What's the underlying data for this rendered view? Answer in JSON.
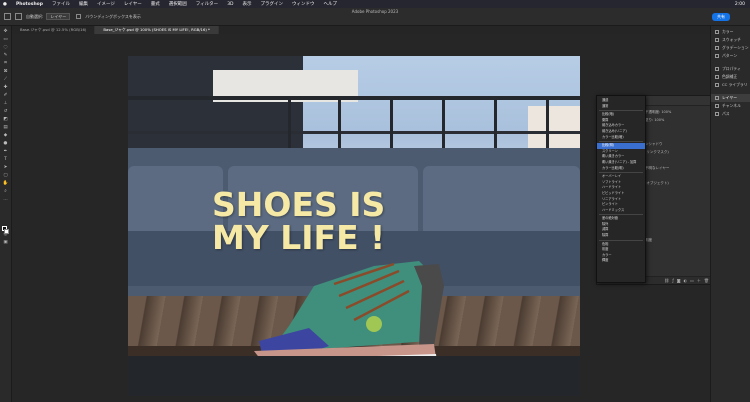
{
  "menubar": {
    "app": "Photoshop",
    "items": [
      "ファイル",
      "編集",
      "イメージ",
      "レイヤー",
      "書式",
      "選択範囲",
      "フィルター",
      "3D",
      "表示",
      "プラグイン",
      "ウィンドウ",
      "ヘルプ"
    ],
    "clock": "2:00"
  },
  "window_title": "Adobe Photoshop 2023",
  "options_bar": {
    "auto_select_label": "自動選択:",
    "auto_select_value": "レイヤー",
    "transform_label": "バウンディングボックスを表示",
    "share_label": "共有"
  },
  "tabs": [
    {
      "label": "Base.ジャケ.psd @ 12.5% (RGB/16)",
      "active": false
    },
    {
      "label": "Base_ジャケ.psd @ 100% (SHOES IS MY LIFE!, RGB/16) *",
      "active": true
    }
  ],
  "canvas": {
    "headline_line1": "SHOES IS",
    "headline_line2": "MY LIFE !"
  },
  "right_panel": {
    "group1": [
      {
        "label": "カラー",
        "icon": "color-icon"
      },
      {
        "label": "スウォッチ",
        "icon": "swatches-icon"
      },
      {
        "label": "グラデーション",
        "icon": "gradient-icon"
      },
      {
        "label": "パターン",
        "icon": "pattern-icon"
      }
    ],
    "group2": [
      {
        "label": "プロパティ",
        "icon": "properties-icon"
      },
      {
        "label": "色調補正",
        "icon": "adjustments-icon"
      },
      {
        "label": "CC ライブラリ",
        "icon": "libraries-icon"
      }
    ],
    "group3": [
      {
        "label": "レイヤー",
        "icon": "layers-icon",
        "selected": true
      },
      {
        "label": "チャンネル",
        "icon": "channels-icon",
        "selected": false
      },
      {
        "label": "パス",
        "icon": "paths-icon",
        "selected": false
      }
    ]
  },
  "layers_panel": {
    "opacity_label": "不透明度:",
    "opacity_value": "100%",
    "fill_label": "塗り:",
    "fill_value": "100%",
    "row_text": "ンシャドウ",
    "row_text2": "(リンクマスク)",
    "row_text3": "不明なレイヤー",
    "row_text4": "(オブジェクト)",
    "row_text5": "明度"
  },
  "blend_menu": {
    "groups": [
      [
        "通過",
        "通常"
      ],
      [
        "比較(暗)",
        "乗算",
        "焼き込みカラー",
        "焼き込み(リニア)",
        "カラー比較(暗)"
      ],
      [
        "比較(明)",
        "スクリーン",
        "覆い焼きカラー",
        "覆い焼き(リニア) - 加算",
        "カラー比較(明)"
      ],
      [
        "オーバーレイ",
        "ソフトライト",
        "ハードライト",
        "ビビッドライト",
        "リニアライト",
        "ピンライト",
        "ハードミックス"
      ],
      [
        "差の絶対値",
        "除外",
        "減算",
        "除算"
      ],
      [
        "色相",
        "彩度",
        "カラー",
        "輝度"
      ]
    ],
    "active_item": "比較(明)"
  }
}
